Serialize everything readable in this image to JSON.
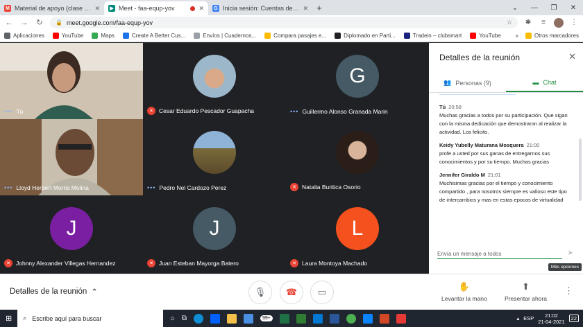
{
  "tabs": [
    {
      "label": "Material de apoyo (clase flujogra...",
      "icon": "gmail-icon",
      "color": "#ea4335"
    },
    {
      "label": "Meet - faa-equp-yov",
      "icon": "meet-icon",
      "color": "#00897b",
      "active": true
    },
    {
      "label": "Inicia sesión: Cuentas de Google",
      "icon": "google-icon",
      "color": "#4285f4"
    }
  ],
  "url": "meet.google.com/faa-equp-yov",
  "bookmarks": [
    {
      "label": "Aplicaciones",
      "color": "#5f6368"
    },
    {
      "label": "YouTube",
      "color": "#ff0000"
    },
    {
      "label": "Maps",
      "color": "#34a853"
    },
    {
      "label": "Create A Better Cus...",
      "color": "#1a73e8"
    },
    {
      "label": "Envíos | Cuadernos...",
      "color": "#9aa0a6"
    },
    {
      "label": "Compara pasajes e...",
      "color": "#fbbc04"
    },
    {
      "label": "Diplomado en Parti...",
      "color": "#202124"
    },
    {
      "label": "Tradein – clubsmart",
      "color": "#1a237e"
    },
    {
      "label": "YouTube",
      "color": "#ff0000"
    }
  ],
  "bookmarks_more": "»",
  "bookmarks_folder": "Otros marcadores",
  "participants": [
    {
      "name": "Tú",
      "type": "video",
      "muted": false
    },
    {
      "name": "Cesar Eduardo Pescador Guapacha",
      "type": "photo",
      "muted": true
    },
    {
      "name": "Guillermo Alonso Granada Marin",
      "type": "letter",
      "letter": "G",
      "color": "#455a64",
      "muted": false
    },
    {
      "name": "Lloyd Herbert Morris Molina",
      "type": "video",
      "muted": false
    },
    {
      "name": "Pedro Nel Cardozo Perez",
      "type": "photo",
      "muted": false
    },
    {
      "name": "Natalia Buritica Osorio",
      "type": "photo",
      "muted": true
    },
    {
      "name": "Johnny Alexander Villegas Hernandez",
      "type": "letter",
      "letter": "J",
      "color": "#7b1fa2",
      "muted": true
    },
    {
      "name": "Juan Esteban Mayorga Batero",
      "type": "letter",
      "letter": "J",
      "color": "#455a64",
      "muted": true
    },
    {
      "name": "Laura Montoya Machado",
      "type": "letter",
      "letter": "L",
      "color": "#f4511e",
      "muted": true
    }
  ],
  "panel": {
    "title": "Detalles de la reunión",
    "tab_people": "Personas (9)",
    "tab_chat": "Chat",
    "messages": [
      {
        "sender": "Tú",
        "time": "20:58",
        "text": "Muchas gracias a todos por su participación. Que sigan con la misma dedicación que demostraron al realizar la actividad. Los felicito."
      },
      {
        "sender": "Keidy Yubelly Maturana Mosquera",
        "time": "21:00",
        "text": "profe a usted por sus ganas de entregarnos sus conocimientos  y por su tiempo. Muchas gracias"
      },
      {
        "sender": "Jennifer Giraldo M",
        "time": "21:01",
        "text": "Muchisimas gracias por el tiempo y conocimiento compartido , para nosotros siempre es valioso este tipo de intercambios y mas en estas epocas de virtualidad"
      }
    ],
    "input_placeholder": "Envía un mensaje a todos",
    "tooltip": "Más opciones"
  },
  "bottom": {
    "details": "Detalles de la reunión",
    "raise_hand": "Levantar la mano",
    "present": "Presentar ahora"
  },
  "taskbar": {
    "search": "Escribe aquí para buscar",
    "badge": "99+",
    "lang": "ESP",
    "time": "21:02",
    "date": "21-04-2021",
    "notifications": "22"
  }
}
